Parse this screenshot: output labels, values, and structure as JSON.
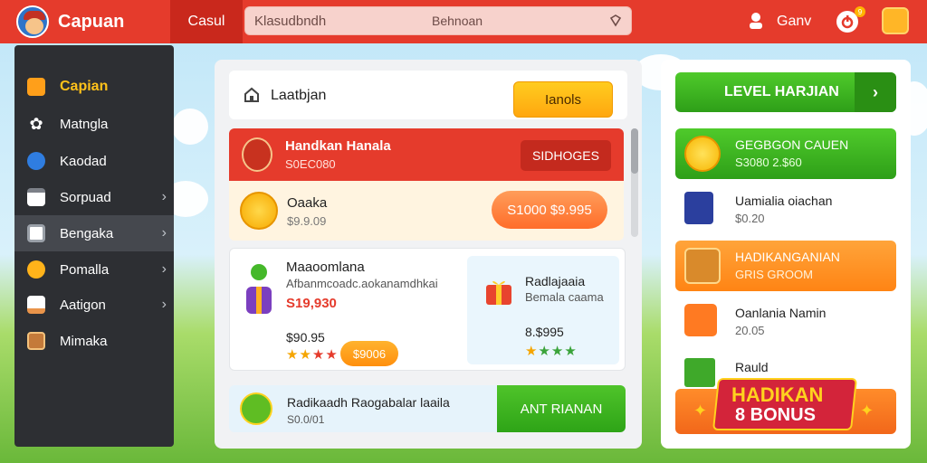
{
  "topbar": {
    "app_title": "Capuan",
    "tab_label": "Casul",
    "search_value": "Klasudbndh",
    "search_secondary": "Behnoan",
    "user_name": "Ganv",
    "notif_count": "9"
  },
  "sidebar": {
    "items": [
      {
        "label": "Capian"
      },
      {
        "label": "Matngla"
      },
      {
        "label": "Kaodad"
      },
      {
        "label": "Sorpuad"
      },
      {
        "label": "Bengaka"
      },
      {
        "label": "Pomalla"
      },
      {
        "label": "Aatigon"
      },
      {
        "label": "Mimaka"
      }
    ]
  },
  "main": {
    "title": "Laatbjan",
    "header_button": "Ianols",
    "featured": {
      "title": "Handkan Hanala",
      "subtitle": "S0EC080",
      "button": "SIDHOGES"
    },
    "coin_row": {
      "title": "Oaaka",
      "subtitle": "$9.9.09",
      "button": "S1000 $9.995"
    },
    "card": {
      "title": "Maaoomlana",
      "subtitle": "Afbanmcoadc.aokanamdhkai",
      "price": "S19,930",
      "footer": "$90.95",
      "button": "$9006"
    },
    "subcard": {
      "title": "Radlajaaia",
      "subtitle": "Bemala caama",
      "footer": "8.$995"
    },
    "bottom": {
      "title": "Radikaadh Raogabalar laaila",
      "subtitle": "S0.0/01",
      "button": "ANT RIANAN"
    }
  },
  "right": {
    "level_button": "LEVEL HARJIAN",
    "rows": [
      {
        "title": "GEGBGON CAUEN",
        "subtitle": "S3080 2.$60"
      },
      {
        "title": "Uamialia oiachan",
        "subtitle": "$0.20"
      },
      {
        "title": "HADIKANGANIAN",
        "subtitle": "GRIS GROOM"
      },
      {
        "title": "Oanlania Namin",
        "subtitle": "20.05"
      },
      {
        "title": "Rauld",
        "subtitle": ""
      }
    ],
    "bonus_line1": "HADIKAN",
    "bonus_line2": "8 BONUS"
  },
  "colors": {
    "brand_red": "#e53b2c",
    "accent_yellow": "#ffc21a",
    "green": "#3fb21f",
    "orange": "#ff7a22",
    "sidebar_bg": "#2d2f33"
  }
}
